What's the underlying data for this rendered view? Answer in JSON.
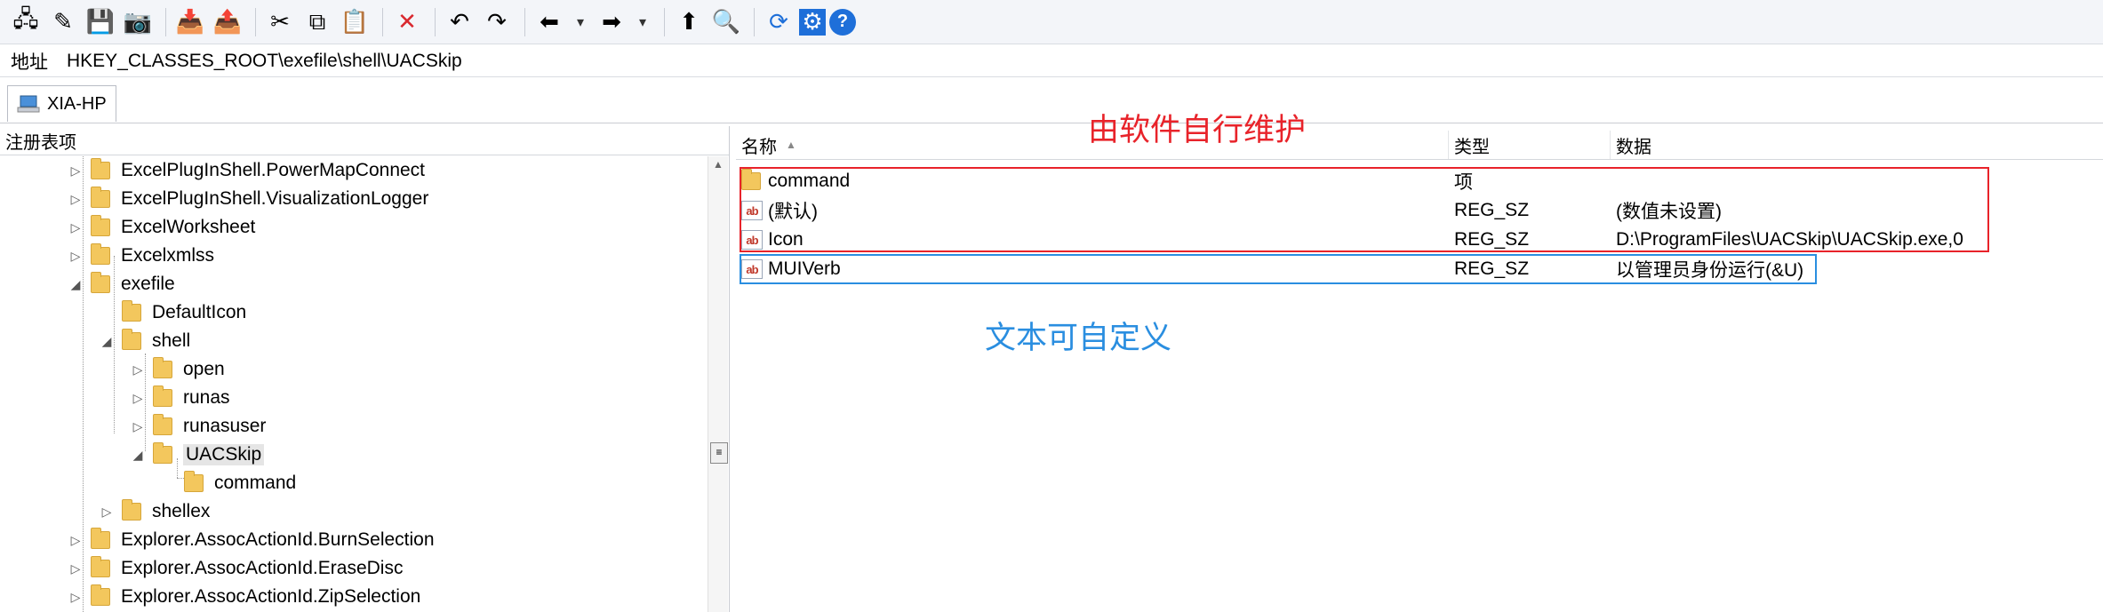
{
  "toolbar": {
    "buttons": [
      {
        "name": "connect-registry-icon",
        "glyph": "🖧"
      },
      {
        "name": "edit-icon",
        "glyph": "✎"
      },
      {
        "name": "save-icon",
        "glyph": "💾"
      },
      {
        "name": "camera-icon",
        "glyph": "📷"
      },
      {
        "name": "import-icon",
        "glyph": "📥"
      },
      {
        "name": "export-icon",
        "glyph": "📤"
      },
      {
        "name": "cut-icon",
        "glyph": "✂"
      },
      {
        "name": "copy-icon",
        "glyph": "⧉"
      },
      {
        "name": "paste-icon",
        "glyph": "📋"
      },
      {
        "name": "delete-icon",
        "glyph": "✕"
      },
      {
        "name": "undo-icon",
        "glyph": "↶"
      },
      {
        "name": "redo-icon",
        "glyph": "↷"
      },
      {
        "name": "back-icon",
        "glyph": "⬅"
      },
      {
        "name": "back-dropdown-icon",
        "glyph": "▾"
      },
      {
        "name": "forward-icon",
        "glyph": "➡"
      },
      {
        "name": "forward-dropdown-icon",
        "glyph": "▾"
      },
      {
        "name": "up-folder-icon",
        "glyph": "⬆"
      },
      {
        "name": "search-icon",
        "glyph": "🔍"
      },
      {
        "name": "refresh-icon",
        "glyph": "⟳"
      },
      {
        "name": "settings-icon",
        "glyph": "⚙"
      },
      {
        "name": "help-icon",
        "glyph": "?"
      }
    ]
  },
  "address": {
    "label": "地址",
    "value": "HKEY_CLASSES_ROOT\\exefile\\shell\\UACSkip"
  },
  "tab": {
    "label": "XIA-HP"
  },
  "left_panel": {
    "header": "注册表项"
  },
  "tree": [
    {
      "label": "ExcelPlugInShell.PowerMapConnect",
      "expander": "▷"
    },
    {
      "label": "ExcelPlugInShell.VisualizationLogger",
      "expander": "▷"
    },
    {
      "label": "ExcelWorksheet",
      "expander": "▷"
    },
    {
      "label": "Excelxmlss",
      "expander": "▷"
    },
    {
      "label": "exefile",
      "expander": "◢"
    },
    {
      "label": "DefaultIcon",
      "expander": ""
    },
    {
      "label": "shell",
      "expander": "◢"
    },
    {
      "label": "open",
      "expander": "▷"
    },
    {
      "label": "runas",
      "expander": "▷"
    },
    {
      "label": "runasuser",
      "expander": "▷"
    },
    {
      "label": "UACSkip",
      "expander": "◢"
    },
    {
      "label": "command",
      "expander": ""
    },
    {
      "label": "shellex",
      "expander": "▷"
    },
    {
      "label": "Explorer.AssocActionId.BurnSelection",
      "expander": "▷"
    },
    {
      "label": "Explorer.AssocActionId.EraseDisc",
      "expander": "▷"
    },
    {
      "label": "Explorer.AssocActionId.ZipSelection",
      "expander": "▷"
    }
  ],
  "values_table": {
    "headers": {
      "name": "名称",
      "type": "类型",
      "data": "数据"
    },
    "sort_indicator": "▲",
    "rows": [
      {
        "icon": "folder",
        "name": "command",
        "type": "项",
        "data": ""
      },
      {
        "icon": "ab",
        "name": "(默认)",
        "type": "REG_SZ",
        "data": "(数值未设置)"
      },
      {
        "icon": "ab",
        "name": "Icon",
        "type": "REG_SZ",
        "data": "D:\\ProgramFiles\\UACSkip\\UACSkip.exe,0"
      },
      {
        "icon": "ab",
        "name": "MUIVerb",
        "type": "REG_SZ",
        "data": "以管理员身份运行(&U)"
      }
    ]
  },
  "annotations": {
    "red": "由软件自行维护",
    "blue": "文本可自定义"
  },
  "colors": {
    "annotation_red": "#e8232a",
    "annotation_blue": "#2a8ee0"
  }
}
